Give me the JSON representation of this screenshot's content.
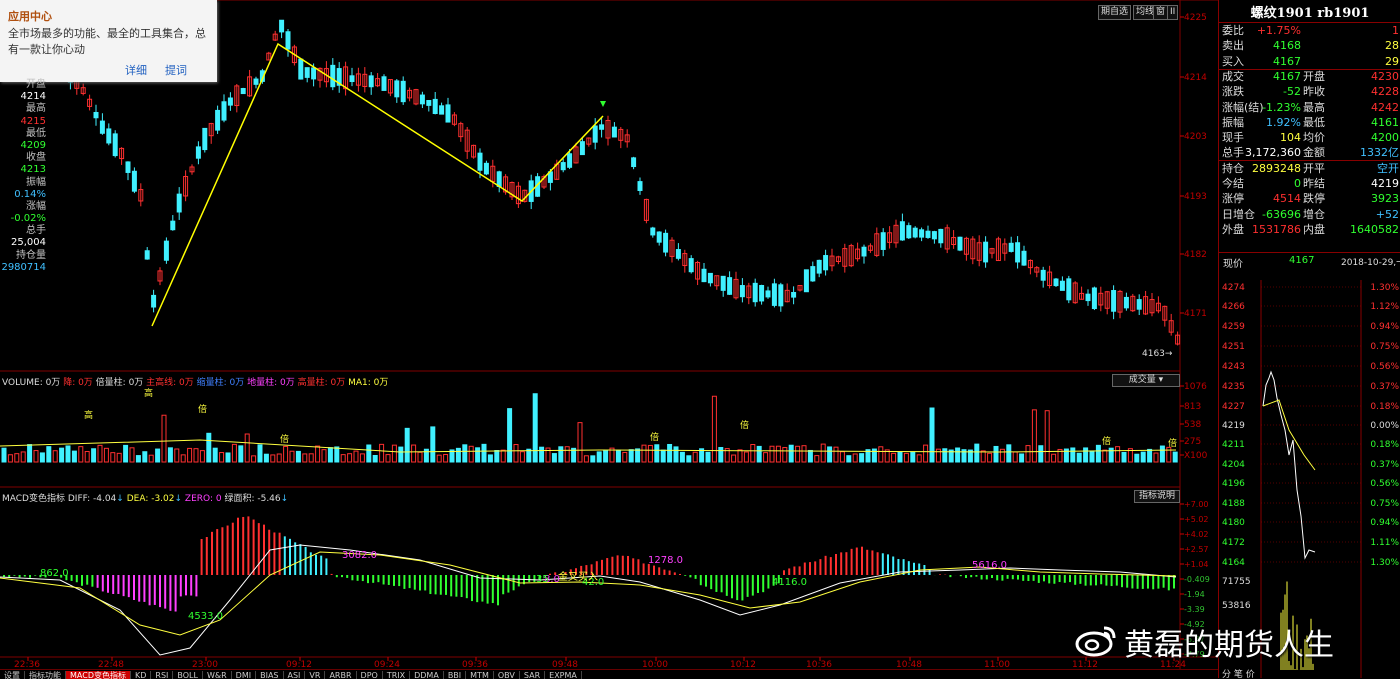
{
  "popup": {
    "title": "应用中心",
    "desc": "全市场最多的功能、最全的工具集合，总有一款让你心动",
    "link_detail": "详细",
    "link_hint": "提词"
  },
  "toolbar": {
    "btn1": "期自选",
    "btn2": "均线",
    "btn3": "窗",
    "btn4": "II"
  },
  "infobox": [
    {
      "t": "开盘",
      "c": "#c0c0c0"
    },
    {
      "t": "4214",
      "c": "#ffffff"
    },
    {
      "t": "最高",
      "c": "#c0c0c0"
    },
    {
      "t": "4215",
      "c": "#ff3030"
    },
    {
      "t": "最低",
      "c": "#c0c0c0"
    },
    {
      "t": "4209",
      "c": "#30ff30"
    },
    {
      "t": "收盘",
      "c": "#c0c0c0"
    },
    {
      "t": "4213",
      "c": "#30ff30"
    },
    {
      "t": "振幅",
      "c": "#c0c0c0"
    },
    {
      "t": "0.14%",
      "c": "#40c0ff"
    },
    {
      "t": "涨幅",
      "c": "#c0c0c0"
    },
    {
      "t": "-0.02%",
      "c": "#30ff30"
    },
    {
      "t": "总手",
      "c": "#c0c0c0"
    },
    {
      "t": "25,004",
      "c": "#ffffff"
    },
    {
      "t": "持仓量",
      "c": "#c0c0c0"
    },
    {
      "t": "2980714",
      "c": "#40c0ff"
    }
  ],
  "price_axis": [
    "4225",
    "4214",
    "4203",
    "4193",
    "4182",
    "4171"
  ],
  "last_price_tag": "4163",
  "volume_label": {
    "vol": "VOLUME: 0万",
    "items": [
      "降: 0万",
      "倍量柱: 0万",
      "主高线: 0万",
      "缩量柱: 0万",
      "地量柱: 0万",
      "高量柱: 0万",
      "MA1: 0万"
    ]
  },
  "volume_axis": [
    "1076",
    "813",
    "538",
    "275",
    "X100"
  ],
  "volume_dropdown": "成交量",
  "volume_marks": [
    "高",
    "高",
    "倍",
    "倍",
    "倍",
    "倍",
    "倍",
    "倍"
  ],
  "macd_label": {
    "name": "MACD变色指标",
    "diff": "DIFF: -4.04",
    "dea": "DEA: -3.02",
    "zero": "ZERO: 0",
    "area": "绿面积: -5.46"
  },
  "macd_button": "指标说明",
  "macd_axis": [
    "+7.00",
    "+5.02",
    "+4.02",
    "+2.57",
    "+1.04",
    "-0.409",
    "-1.94",
    "-3.39",
    "-4.92",
    "-6.37",
    "-7.79"
  ],
  "macd_annotations": [
    "862.0",
    "4533.0",
    "3082.0",
    "8.0",
    "42.0",
    "1278.0",
    "35",
    "金叉买入",
    "4116.0",
    "5616.0"
  ],
  "time_axis": [
    "22:36",
    "22:48",
    "23:00",
    "09:12",
    "09:24",
    "09:36",
    "09:48",
    "10:00",
    "10:12",
    "10:36",
    "10:48",
    "11:00",
    "11:12",
    "11:24"
  ],
  "tabs": [
    "设置",
    "指标功能",
    "MACD变色指标",
    "KD",
    "RSI",
    "BOLL",
    "W&R",
    "DMI",
    "BIAS",
    "ASI",
    "VR",
    "ARBR",
    "DPO",
    "TRIX",
    "DDMA",
    "BBI",
    "MTM",
    "OBV",
    "SAR",
    "EXPMA"
  ],
  "right_panel": {
    "title": "螺纹1901 rb1901",
    "rows": [
      {
        "l": "委比",
        "v": "+1.75%",
        "vc": "#ff3030",
        "r": "",
        "rv": "1",
        "rvc": "#ff3030"
      },
      {
        "l": "卖出",
        "v": "4168",
        "vc": "#30ff30",
        "r": "",
        "rv": "28",
        "rvc": "#ffff40"
      },
      {
        "l": "买入",
        "v": "4167",
        "vc": "#30ff30",
        "r": "",
        "rv": "29",
        "rvc": "#ffff40"
      },
      {
        "l": "成交",
        "v": "4167",
        "vc": "#30ff30",
        "r": "开盘",
        "rv": "4230",
        "rvc": "#ff3030"
      },
      {
        "l": "涨跌",
        "v": "-52",
        "vc": "#30ff30",
        "r": "昨收",
        "rv": "4228",
        "rvc": "#ff3030"
      },
      {
        "l": "涨幅(结)",
        "v": "-1.23%",
        "vc": "#30ff30",
        "r": "最高",
        "rv": "4242",
        "rvc": "#ff3030"
      },
      {
        "l": "振幅",
        "v": "1.92%",
        "vc": "#40c0ff",
        "r": "最低",
        "rv": "4161",
        "rvc": "#30ff30"
      },
      {
        "l": "现手",
        "v": "104",
        "vc": "#ffff40",
        "r": "均价",
        "rv": "4200",
        "rvc": "#30ff30"
      },
      {
        "l": "总手",
        "v": "3,172,360",
        "vc": "#ffffff",
        "r": "金额",
        "rv": "1332亿",
        "rvc": "#40c0ff"
      },
      {
        "l": "持仓",
        "v": "2893248",
        "vc": "#ffff40",
        "r": "开平",
        "rv": "空开",
        "rvc": "#40c0ff"
      },
      {
        "l": "今结",
        "v": "0",
        "vc": "#30ff30",
        "r": "昨结",
        "rv": "4219",
        "rvc": "#ffffff"
      },
      {
        "l": "涨停",
        "v": "4514",
        "vc": "#ff3030",
        "r": "跌停",
        "rv": "3923",
        "rvc": "#30ff30"
      },
      {
        "l": "日增仓",
        "v": "-63696",
        "vc": "#30ff30",
        "r": "增仓",
        "rv": "+52",
        "rvc": "#40c0ff"
      },
      {
        "l": "外盘",
        "v": "1531786",
        "vc": "#ff3030",
        "r": "内盘",
        "rv": "1640582",
        "rvc": "#30ff30"
      }
    ],
    "current_label": "现价",
    "current_value": "4167",
    "date": "2018-10-29,一",
    "mini_left": [
      "4274",
      "4266",
      "4259",
      "4251",
      "4243",
      "4235",
      "4227",
      "4219",
      "4211",
      "4204",
      "4196",
      "4188",
      "4180",
      "4172",
      "4164"
    ],
    "mini_right": [
      "1.30%",
      "1.12%",
      "0.94%",
      "0.75%",
      "0.56%",
      "0.37%",
      "0.18%",
      "0.00%",
      "0.18%",
      "0.37%",
      "0.56%",
      "0.75%",
      "0.94%",
      "1.11%",
      "1.30%"
    ],
    "mini_vol": [
      "71755",
      "53816"
    ],
    "bottom": "分 笔 价"
  },
  "watermark": "黄磊的期货人生",
  "colors": {
    "up": "#ff3030",
    "down": "#40f0ff",
    "zigzag": "#ffff00",
    "grid": "#800000"
  }
}
